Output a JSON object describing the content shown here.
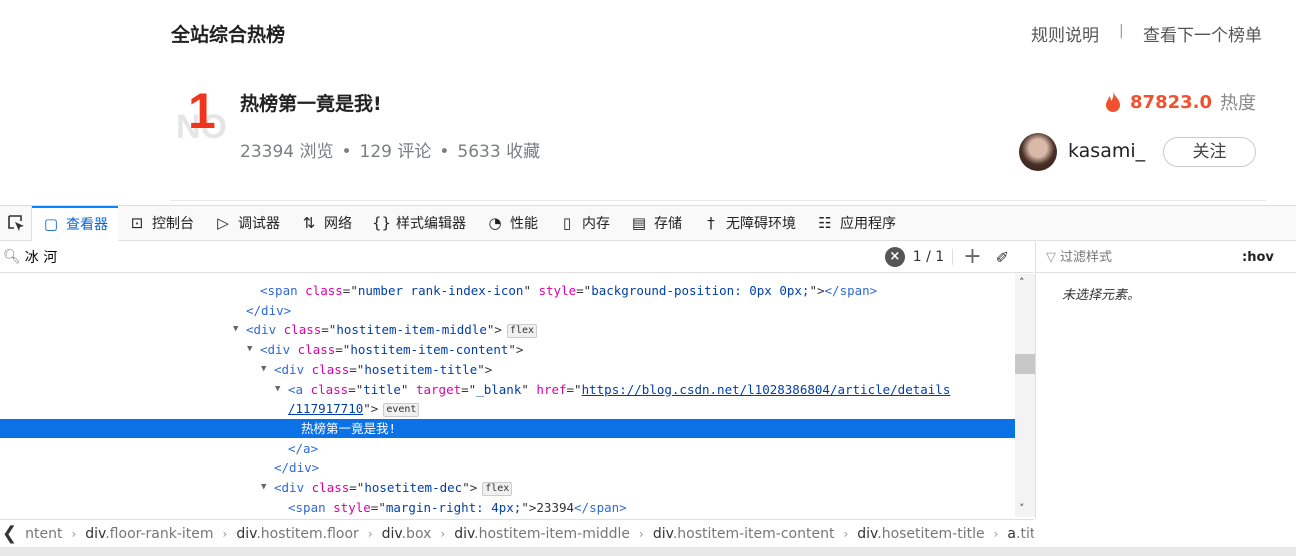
{
  "page": {
    "title": "全站综合热榜",
    "links": [
      "规则说明",
      "查看下一个榜单"
    ],
    "link_sep": "|"
  },
  "item": {
    "rank": "1",
    "title": "热榜第一竟是我!",
    "stats": [
      "23394 浏览",
      "129 评论",
      "5633 收藏"
    ],
    "stat_sep": "•",
    "heat_value": "87823.0",
    "heat_label": "热度",
    "heat_color": "#f0512f",
    "author": "kasami_",
    "follow_label": "关注"
  },
  "devtools": {
    "tabs": [
      {
        "label": "查看器",
        "icon": "inspector-icon",
        "selected": true
      },
      {
        "label": "控制台",
        "icon": "console-icon"
      },
      {
        "label": "调试器",
        "icon": "debugger-icon"
      },
      {
        "label": "网络",
        "icon": "network-icon"
      },
      {
        "label": "样式编辑器",
        "icon": "style-editor-icon"
      },
      {
        "label": "性能",
        "icon": "performance-icon"
      },
      {
        "label": "内存",
        "icon": "memory-icon"
      },
      {
        "label": "存储",
        "icon": "storage-icon"
      },
      {
        "label": "无障碍环境",
        "icon": "accessibility-icon"
      },
      {
        "label": "应用程序",
        "icon": "application-icon"
      }
    ],
    "search": {
      "value": "冰 河",
      "count": "1 / 1"
    },
    "filter": {
      "placeholder": "过滤样式",
      "hov": ":hov"
    },
    "no_selection": "未选择元素。",
    "markup_lines": [
      {
        "indent": 260,
        "parts": [
          [
            "tg",
            "<span "
          ],
          [
            "an",
            "class"
          ],
          [
            "pu",
            "=\""
          ],
          [
            "av",
            "number rank-index-icon"
          ],
          [
            "pu",
            "\" "
          ],
          [
            "an",
            "style"
          ],
          [
            "pu",
            "=\""
          ],
          [
            "av",
            "background-position: 0px 0px;"
          ],
          [
            "pu",
            "\">"
          ],
          [
            "tg",
            "</span>"
          ]
        ]
      },
      {
        "indent": 246,
        "parts": [
          [
            "tg",
            "</div>"
          ]
        ]
      },
      {
        "indent": 246,
        "toggle": true,
        "parts": [
          [
            "tg",
            "<div "
          ],
          [
            "an",
            "class"
          ],
          [
            "pu",
            "=\""
          ],
          [
            "av",
            "hostitem-item-middle"
          ],
          [
            "pu",
            "\">"
          ]
        ],
        "badge": "flex"
      },
      {
        "indent": 260,
        "toggle": true,
        "parts": [
          [
            "tg",
            "<div "
          ],
          [
            "an",
            "class"
          ],
          [
            "pu",
            "=\""
          ],
          [
            "av",
            "hostitem-item-content"
          ],
          [
            "pu",
            "\">"
          ]
        ]
      },
      {
        "indent": 274,
        "toggle": true,
        "parts": [
          [
            "tg",
            "<div "
          ],
          [
            "an",
            "class"
          ],
          [
            "pu",
            "=\""
          ],
          [
            "av",
            "hosetitem-title"
          ],
          [
            "pu",
            "\">"
          ]
        ]
      },
      {
        "indent": 288,
        "toggle": true,
        "parts": [
          [
            "tg",
            "<a "
          ],
          [
            "an",
            "class"
          ],
          [
            "pu",
            "=\""
          ],
          [
            "av",
            "title"
          ],
          [
            "pu",
            "\" "
          ],
          [
            "an",
            "target"
          ],
          [
            "pu",
            "=\""
          ],
          [
            "av",
            "_blank"
          ],
          [
            "pu",
            "\" "
          ],
          [
            "an",
            "href"
          ],
          [
            "pu",
            "=\""
          ],
          [
            "url",
            "https://blog.csdn.net/l1028386804/article/details"
          ]
        ]
      },
      {
        "indent": 288,
        "parts": [
          [
            "url",
            "/117917710"
          ],
          [
            "pu",
            "\">"
          ]
        ],
        "badge": "event"
      },
      {
        "indent": 301,
        "selected": true,
        "parts": [
          [
            "",
            "热榜第一竟是我!"
          ]
        ]
      },
      {
        "indent": 288,
        "parts": [
          [
            "tg",
            "</a>"
          ]
        ]
      },
      {
        "indent": 274,
        "parts": [
          [
            "tg",
            "</div>"
          ]
        ]
      },
      {
        "indent": 274,
        "toggle": true,
        "parts": [
          [
            "tg",
            "<div "
          ],
          [
            "an",
            "class"
          ],
          [
            "pu",
            "=\""
          ],
          [
            "av",
            "hosetitem-dec"
          ],
          [
            "pu",
            "\">"
          ]
        ],
        "badge": "flex"
      },
      {
        "indent": 288,
        "parts": [
          [
            "tg",
            "<span "
          ],
          [
            "an",
            "style"
          ],
          [
            "pu",
            "=\""
          ],
          [
            "av",
            "margin-right: 4px;"
          ],
          [
            "pu",
            "\">"
          ],
          [
            "pu",
            "23394"
          ],
          [
            "tg",
            "</span>"
          ]
        ]
      }
    ],
    "breadcrumbs": [
      {
        "tag": "",
        "cls": "ntent"
      },
      {
        "tag": "div",
        "cls": ".floor-rank-item"
      },
      {
        "tag": "div",
        "cls": ".hostitem.floor"
      },
      {
        "tag": "div",
        "cls": ".box"
      },
      {
        "tag": "div",
        "cls": ".hostitem-item-middle"
      },
      {
        "tag": "div",
        "cls": ".hostitem-item-content"
      },
      {
        "tag": "div",
        "cls": ".hosetitem-title"
      },
      {
        "tag": "a",
        "cls": ".title"
      }
    ]
  }
}
